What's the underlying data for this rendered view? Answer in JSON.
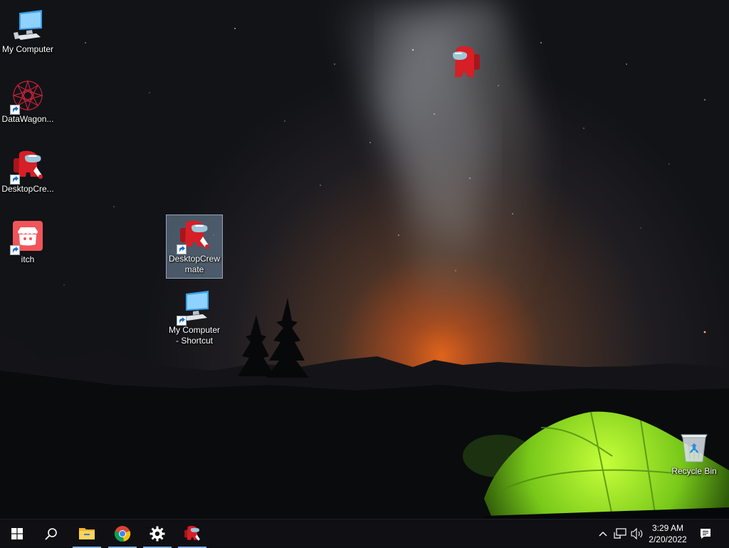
{
  "desktop": {
    "icons": [
      {
        "label": "My Computer",
        "icon": "computer-icon"
      },
      {
        "label": "DataWagon...",
        "icon": "datawagon-icon"
      },
      {
        "label": "DesktopCre...",
        "icon": "crewmate-icon"
      },
      {
        "label": "itch",
        "icon": "itch-icon"
      },
      {
        "label": "DesktopCrew\nmate",
        "icon": "crewmate-icon"
      },
      {
        "label": "My Computer\n- Shortcut",
        "icon": "computer-icon"
      },
      {
        "label": "Recycle Bin",
        "icon": "recycle-bin-icon"
      }
    ]
  },
  "taskbar": {
    "start": "windows-start-icon",
    "search": "search-icon",
    "pinned": [
      "file-explorer-icon",
      "chrome-icon",
      "settings-gear-icon",
      "crewmate-icon"
    ],
    "tray": [
      "chevron-up-icon",
      "network-icon",
      "volume-icon"
    ],
    "clock": {
      "time": "3:29 AM",
      "date": "2/20/2022"
    },
    "notifications": "notification-center-icon",
    "accent_color": "#7fb4e6"
  }
}
